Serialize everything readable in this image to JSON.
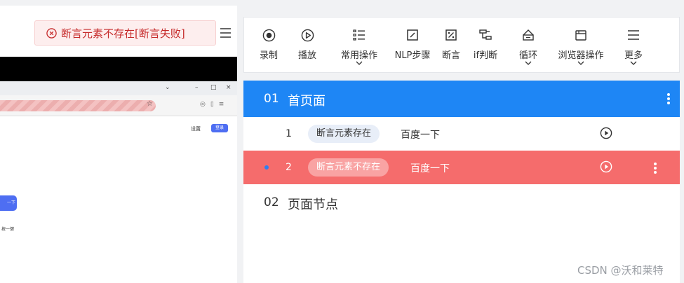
{
  "assertion": {
    "status_text": "断言元素不存在[断言失败]"
  },
  "screenshot": {
    "settings_link": "设置",
    "login_button": "登录",
    "search_button": "一下",
    "small_text": "按一键"
  },
  "toolbar": {
    "items": [
      {
        "label": "录制",
        "icon": "record-icon",
        "dropdown": false
      },
      {
        "label": "播放",
        "icon": "play-icon",
        "dropdown": false
      },
      {
        "label": "常用操作",
        "icon": "list-icon",
        "dropdown": true
      },
      {
        "label": "NLP步骤",
        "icon": "nlp-icon",
        "dropdown": false
      },
      {
        "label": "断言",
        "icon": "assert-icon",
        "dropdown": false
      },
      {
        "label": "if判断",
        "icon": "if-icon",
        "dropdown": false
      },
      {
        "label": "循环",
        "icon": "loop-icon",
        "dropdown": true
      },
      {
        "label": "浏览器操作",
        "icon": "browser-icon",
        "dropdown": true
      },
      {
        "label": "更多",
        "icon": "more-icon",
        "dropdown": true
      }
    ]
  },
  "pages": [
    {
      "num": "01",
      "title": "首页面",
      "steps": [
        {
          "num": "1",
          "action": "断言元素存在",
          "target": "百度一下"
        },
        {
          "num": "2",
          "action": "断言元素不存在",
          "target": "百度一下"
        }
      ]
    },
    {
      "num": "02",
      "title": "页面节点"
    }
  ],
  "watermark": "CSDN @沃和莱特",
  "colors": {
    "accent": "#1e86f5",
    "error_row": "#f56c6c",
    "error_text": "#c62b2b"
  }
}
